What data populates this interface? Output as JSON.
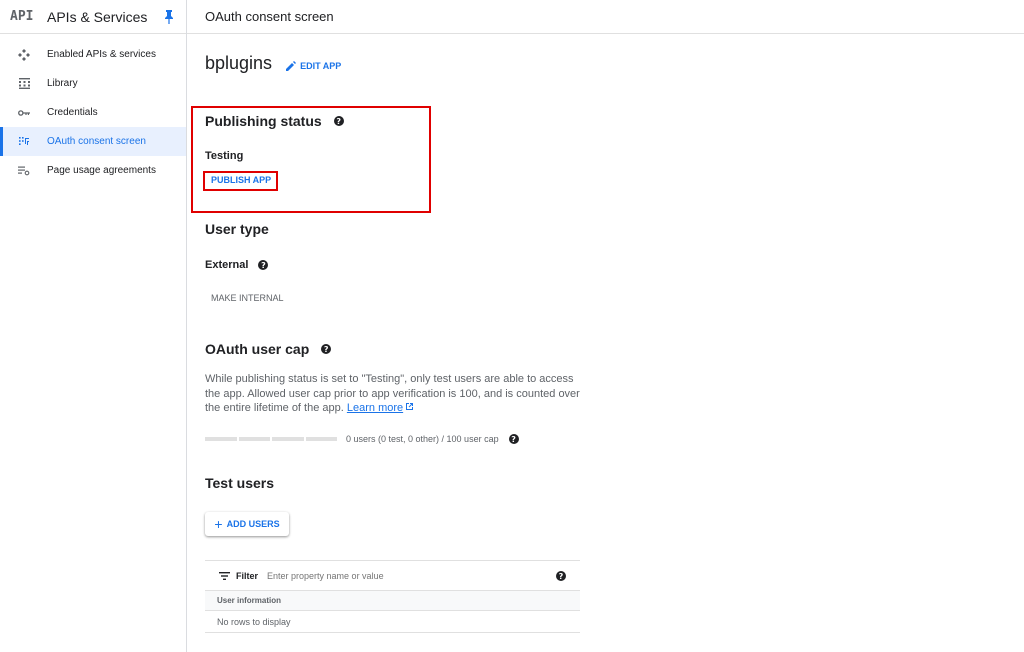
{
  "sidebar": {
    "logo": "API",
    "title": "APIs & Services",
    "items": [
      {
        "label": "Enabled APIs & services",
        "icon": "apis-diamond-icon"
      },
      {
        "label": "Library",
        "icon": "library-grid-icon"
      },
      {
        "label": "Credentials",
        "icon": "key-icon"
      },
      {
        "label": "OAuth consent screen",
        "icon": "consent-dots-icon",
        "active": true
      },
      {
        "label": "Page usage agreements",
        "icon": "settings-list-icon"
      }
    ]
  },
  "topbar": {
    "title": "OAuth consent screen"
  },
  "app": {
    "name": "bplugins",
    "edit_label": "EDIT APP"
  },
  "publishing": {
    "title": "Publishing status",
    "status": "Testing",
    "publish_label": "PUBLISH APP"
  },
  "user_type": {
    "title": "User type",
    "value": "External",
    "make_internal_label": "MAKE INTERNAL"
  },
  "user_cap": {
    "title": "OAuth user cap",
    "description": "While publishing status is set to \"Testing\", only test users are able to access the app. Allowed user cap prior to app verification is 100, and is counted over the entire lifetime of the app.",
    "learn_more": "Learn more",
    "cap_text": "0 users (0 test, 0 other) / 100 user cap",
    "users_used": 0,
    "users_cap": 100
  },
  "test_users": {
    "title": "Test users",
    "add_label": "ADD USERS",
    "filter_label": "Filter",
    "filter_placeholder": "Enter property name or value",
    "column_header": "User information",
    "empty_text": "No rows to display"
  },
  "colors": {
    "accent": "#1a73e8",
    "highlight": "#e00000"
  }
}
